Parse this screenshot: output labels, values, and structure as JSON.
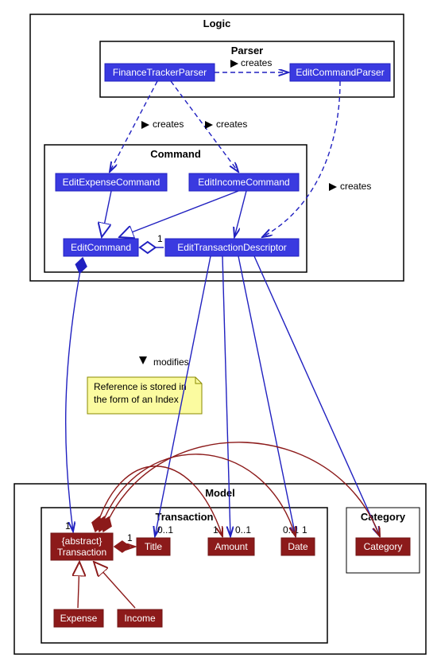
{
  "packages": {
    "logic": "Logic",
    "parser": "Parser",
    "command": "Command",
    "model": "Model",
    "transaction": "Transaction",
    "category": "Category"
  },
  "classes": {
    "financeTrackerParser": "FinanceTrackerParser",
    "editCommandParser": "EditCommandParser",
    "editExpenseCommand": "EditExpenseCommand",
    "editIncomeCommand": "EditIncomeCommand",
    "editCommand": "EditCommand",
    "editTransactionDescriptor": "EditTransactionDescriptor",
    "abstractTransaction1": "{abstract}",
    "abstractTransaction2": "Transaction",
    "title": "Title",
    "amount": "Amount",
    "date": "Date",
    "category": "Category",
    "expense": "Expense",
    "income": "Income"
  },
  "labels": {
    "creates": "creates",
    "modifies": "modifies",
    "one": "1",
    "zeroOne": "0..1"
  },
  "note": {
    "line1": "Reference is stored in",
    "line2": "the form of an Index"
  }
}
